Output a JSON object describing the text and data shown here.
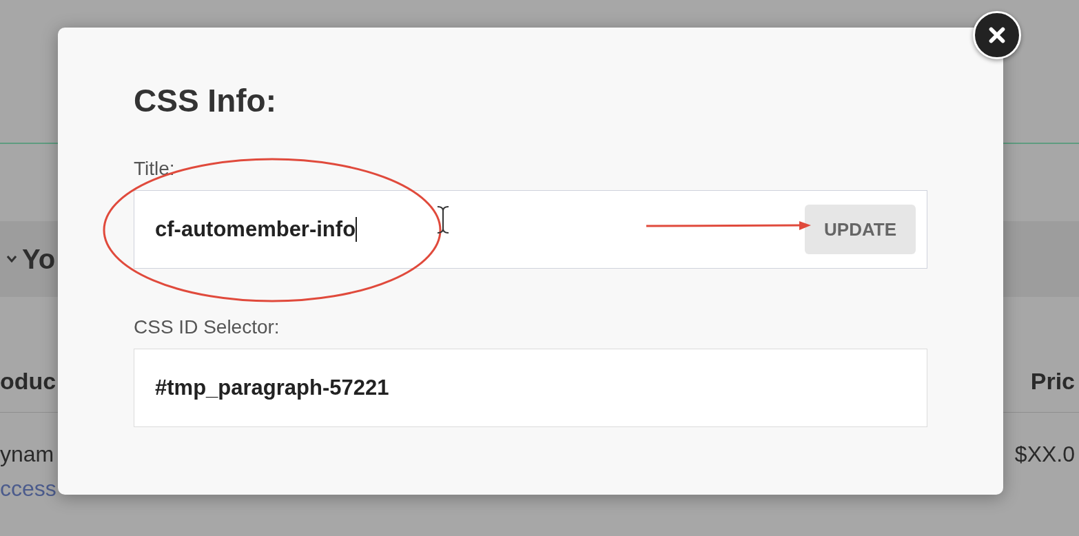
{
  "background": {
    "section_header": "Yo",
    "columns": [
      "oduc",
      "Pric"
    ],
    "rows": [
      {
        "cells": [
          "ynam",
          "$XX.0"
        ],
        "link": "ccess"
      }
    ]
  },
  "dialog": {
    "title": "CSS Info:",
    "fields": [
      {
        "label": "Title:",
        "value": "cf-automember-info",
        "focused": true,
        "button": "UPDATE"
      },
      {
        "label": "CSS ID Selector:",
        "value": "#tmp_paragraph-57221",
        "focused": false
      }
    ]
  }
}
